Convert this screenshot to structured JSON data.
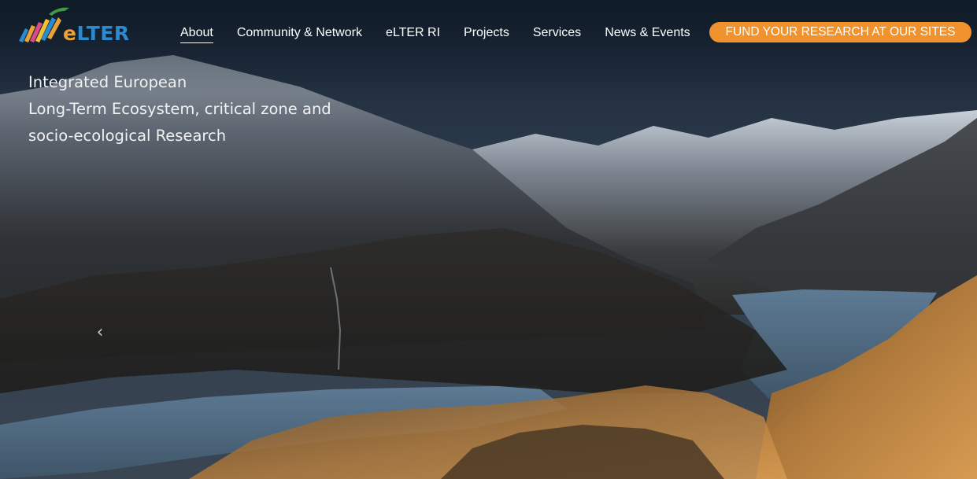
{
  "logo": {
    "text_e": "e",
    "text_rest": "LTER",
    "icon": "elter-logo-icon"
  },
  "nav": {
    "items": [
      {
        "label": "About",
        "active": true
      },
      {
        "label": "Community & Network",
        "active": false
      },
      {
        "label": "eLTER RI",
        "active": false
      },
      {
        "label": "Projects",
        "active": false
      },
      {
        "label": "Services",
        "active": false
      },
      {
        "label": "News & Events",
        "active": false
      }
    ],
    "cta_label": "FUND YOUR RESEARCH AT OUR SITES"
  },
  "hero": {
    "tagline_lines": [
      "Integrated European",
      "Long-Term Ecosystem, critical zone and",
      "socio-ecological Research"
    ],
    "prev_arrow": "‹",
    "background_image": "mountain-lake-landscape"
  },
  "colors": {
    "cta": "#f0922e",
    "logo_orange": "#e8a236",
    "logo_blue": "#2a8bd0",
    "nav_text": "#ffffff"
  }
}
